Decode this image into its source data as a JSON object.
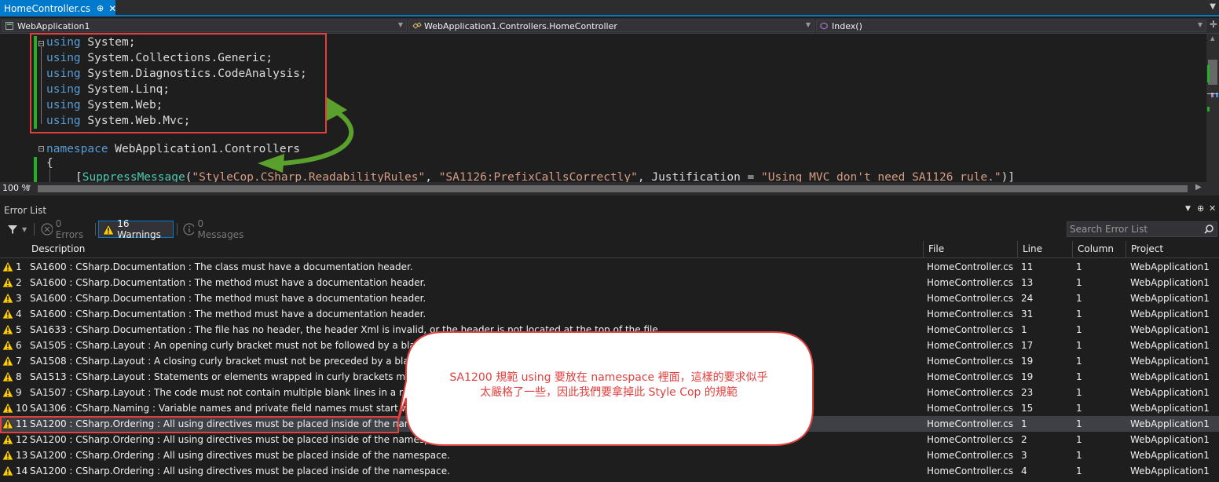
{
  "tab": {
    "title": "HomeController.cs",
    "pin": "⊕",
    "close": "✕"
  },
  "nav": {
    "project": "WebApplication1",
    "class_name": "WebApplication1.Controllers.HomeController",
    "member": "Index()"
  },
  "code": {
    "usings": [
      {
        "kw": "using",
        "ns": " System;"
      },
      {
        "kw": "using",
        "ns": " System.Collections.Generic;"
      },
      {
        "kw": "using",
        "ns": " System.Diagnostics.CodeAnalysis;"
      },
      {
        "kw": "using",
        "ns": " System.Linq;"
      },
      {
        "kw": "using",
        "ns": " System.Web;"
      },
      {
        "kw": "using",
        "ns": " System.Web.Mvc;"
      }
    ],
    "ns_kw": "namespace",
    "ns_name": " WebApplication1.Controllers",
    "brace": "{",
    "attr_open": "[",
    "attr_name": "SuppressMessage",
    "attr_p1": "(",
    "attr_s1": "\"StyleCop.CSharp.ReadabilityRules\"",
    "attr_c1": ", ",
    "attr_s2": "\"SA1126:PrefixCallsCorrectly\"",
    "attr_c2": ", Justification = ",
    "attr_s3": "\"Using MVC don't need SA1126 rule.\"",
    "attr_close": ")]"
  },
  "zoom": "100 %",
  "error_list": {
    "title": "Error List",
    "errors_label": "0 Errors",
    "warnings_label": "16 Warnings",
    "messages_label": "0 Messages",
    "search_placeholder": "Search Error List",
    "columns": {
      "description": "Description",
      "file": "File",
      "line": "Line",
      "column": "Column",
      "project": "Project"
    },
    "rows": [
      {
        "num": "1",
        "desc": "SA1600 : CSharp.Documentation : The class must have a documentation header.",
        "file": "HomeController.cs",
        "line": "11",
        "col": "1",
        "project": "WebApplication1"
      },
      {
        "num": "2",
        "desc": "SA1600 : CSharp.Documentation : The method must have a documentation header.",
        "file": "HomeController.cs",
        "line": "13",
        "col": "1",
        "project": "WebApplication1"
      },
      {
        "num": "3",
        "desc": "SA1600 : CSharp.Documentation : The method must have a documentation header.",
        "file": "HomeController.cs",
        "line": "24",
        "col": "1",
        "project": "WebApplication1"
      },
      {
        "num": "4",
        "desc": "SA1600 : CSharp.Documentation : The method must have a documentation header.",
        "file": "HomeController.cs",
        "line": "31",
        "col": "1",
        "project": "WebApplication1"
      },
      {
        "num": "5",
        "desc": "SA1633 : CSharp.Documentation : The file has no header, the header Xml is invalid, or the header is not located at the top of the file.",
        "file": "HomeController.cs",
        "line": "1",
        "col": "1",
        "project": "WebApplication1"
      },
      {
        "num": "6",
        "desc": "SA1505 : CSharp.Layout : An opening curly bracket must not be followed by a blank line.",
        "file": "HomeController.cs",
        "line": "17",
        "col": "1",
        "project": "WebApplication1"
      },
      {
        "num": "7",
        "desc": "SA1508 : CSharp.Layout : A closing curly bracket must not be preceded by a blank line.",
        "file": "HomeController.cs",
        "line": "19",
        "col": "1",
        "project": "WebApplication1"
      },
      {
        "num": "8",
        "desc": "SA1513 : CSharp.Layout : Statements or elements wrapped in curly brackets must be followed by a blank line.",
        "file": "HomeController.cs",
        "line": "19",
        "col": "1",
        "project": "WebApplication1"
      },
      {
        "num": "9",
        "desc": "SA1507 : CSharp.Layout : The code must not contain multiple blank lines in a row.",
        "file": "HomeController.cs",
        "line": "23",
        "col": "1",
        "project": "WebApplication1"
      },
      {
        "num": "10",
        "desc": "SA1306 : CSharp.Naming : Variable names and private field names must start with a lower-case letter.",
        "file": "HomeController.cs",
        "line": "15",
        "col": "1",
        "project": "WebApplication1"
      },
      {
        "num": "11",
        "desc": "SA1200 : CSharp.Ordering : All using directives must be placed inside of the namespace.",
        "file": "HomeController.cs",
        "line": "1",
        "col": "1",
        "project": "WebApplication1"
      },
      {
        "num": "12",
        "desc": "SA1200 : CSharp.Ordering : All using directives must be placed inside of the namespace.",
        "file": "HomeController.cs",
        "line": "2",
        "col": "1",
        "project": "WebApplication1"
      },
      {
        "num": "13",
        "desc": "SA1200 : CSharp.Ordering : All using directives must be placed inside of the namespace.",
        "file": "HomeController.cs",
        "line": "3",
        "col": "1",
        "project": "WebApplication1"
      },
      {
        "num": "14",
        "desc": "SA1200 : CSharp.Ordering : All using directives must be placed inside of the namespace.",
        "file": "HomeController.cs",
        "line": "4",
        "col": "1",
        "project": "WebApplication1"
      }
    ]
  },
  "callout": {
    "line1": "SA1200 規範 using 要放在 namespace 裡面，這樣的要求似乎",
    "line2": "太嚴格了一些，因此我們要拿掉此 Style Cop 的規範"
  },
  "colors": {
    "accent": "#007acc",
    "annotation": "#e0413f",
    "arrow": "#5aa02c",
    "warning": "#ffcc00"
  }
}
